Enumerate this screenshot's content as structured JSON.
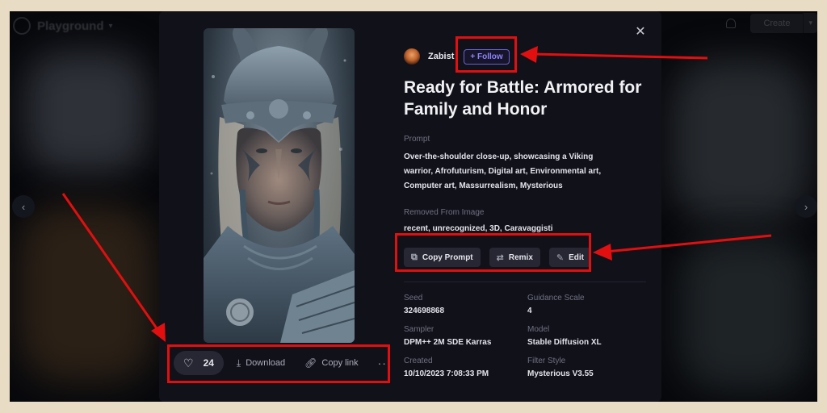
{
  "background_app": {
    "title": "Playground",
    "create_label": "Create"
  },
  "modal": {
    "close_icon": "close-icon",
    "author": {
      "name": "Zabist",
      "follow_label": "+ Follow"
    },
    "title": "Ready for Battle: Armored for Family and Honor",
    "prompt_label": "Prompt",
    "prompt_text": "Over-the-shoulder close-up, showcasing a Viking warrior, Afrofuturism, Digital art, Environmental art, Computer art, Massurrealism, Mysterious",
    "removed_label": "Removed From Image",
    "removed_text": "recent, unrecognized, 3D, Caravaggisti",
    "buttons": {
      "copy_prompt": "Copy Prompt",
      "remix": "Remix",
      "edit": "Edit"
    },
    "meta": [
      {
        "label": "Seed",
        "value": "324698868"
      },
      {
        "label": "Guidance Scale",
        "value": "4"
      },
      {
        "label": "Sampler",
        "value": "DPM++ 2M SDE Karras"
      },
      {
        "label": "Model",
        "value": "Stable Diffusion XL"
      },
      {
        "label": "Created",
        "value": "10/10/2023 7:08:33 PM"
      },
      {
        "label": "Filter Style",
        "value": "Mysterious V3.55"
      }
    ],
    "actions": {
      "like_count": "24",
      "download_label": "Download",
      "copy_link_label": "Copy link",
      "more_label": "···"
    }
  },
  "colors": {
    "annotation_red": "#e10f0f",
    "accent_purple": "#8e83ff",
    "modal_bg": "#11111a",
    "page_frame": "#e8dcc4"
  }
}
